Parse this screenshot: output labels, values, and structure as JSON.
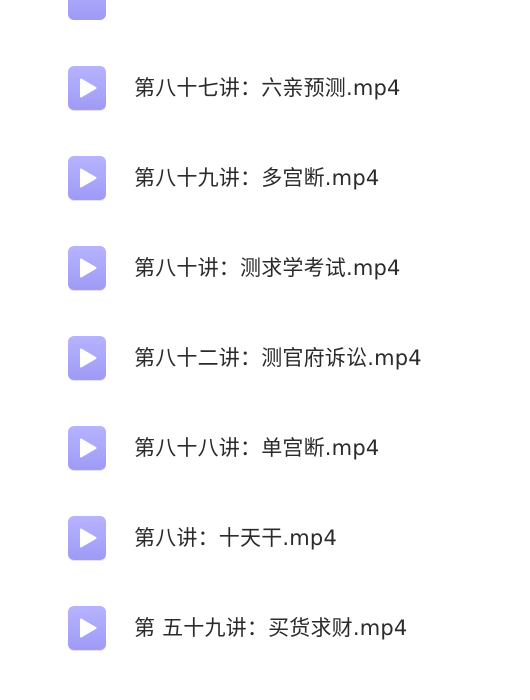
{
  "files": [
    {
      "name": "第八十七讲：六亲预测.mp4",
      "icon": "video-file-icon"
    },
    {
      "name": "第八十九讲：多宫断.mp4",
      "icon": "video-file-icon"
    },
    {
      "name": "第八十讲：测求学考试.mp4",
      "icon": "video-file-icon"
    },
    {
      "name": "第八十二讲：测官府诉讼.mp4",
      "icon": "video-file-icon"
    },
    {
      "name": "第八十八讲：单宫断.mp4",
      "icon": "video-file-icon"
    },
    {
      "name": "第八讲：十天干.mp4",
      "icon": "video-file-icon"
    },
    {
      "name": "第 五十九讲：买货求财.mp4",
      "icon": "video-file-icon"
    }
  ],
  "colors": {
    "icon": "#a8a4fb",
    "text": "#2b2b2b",
    "background": "#ffffff"
  }
}
